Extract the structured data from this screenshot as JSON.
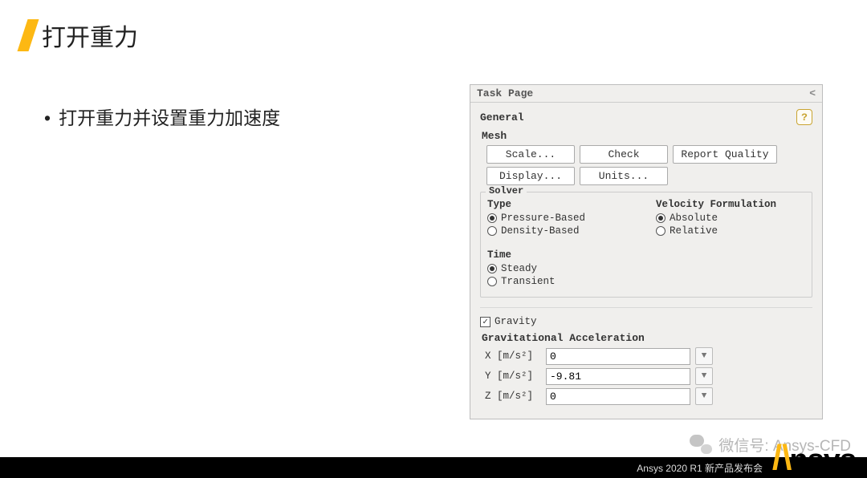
{
  "slide": {
    "title": "打开重力",
    "bullet": "打开重力并设置重力加速度"
  },
  "task_page": {
    "header": "Task Page",
    "general": "General",
    "help": "?",
    "mesh_label": "Mesh",
    "buttons": {
      "scale": "Scale...",
      "check": "Check",
      "report_quality": "Report Quality",
      "display": "Display...",
      "units": "Units..."
    },
    "solver": {
      "group": "Solver",
      "type_label": "Type",
      "velocity_label": "Velocity Formulation",
      "pressure_based": "Pressure-Based",
      "density_based": "Density-Based",
      "absolute": "Absolute",
      "relative": "Relative",
      "time_label": "Time",
      "steady": "Steady",
      "transient": "Transient"
    },
    "gravity": {
      "check_label": "Gravity",
      "accel_label": "Gravitational Acceleration",
      "x_label": "X [m/s²]",
      "x_val": "0",
      "y_label": "Y [m/s²]",
      "y_val": "-9.81",
      "z_label": "Z [m/s²]",
      "z_val": "0"
    }
  },
  "watermark": {
    "text": "微信号: Ansys-CFD"
  },
  "footer": {
    "text": "Ansys 2020 R1 新产品发布会",
    "brand": "nsys"
  }
}
